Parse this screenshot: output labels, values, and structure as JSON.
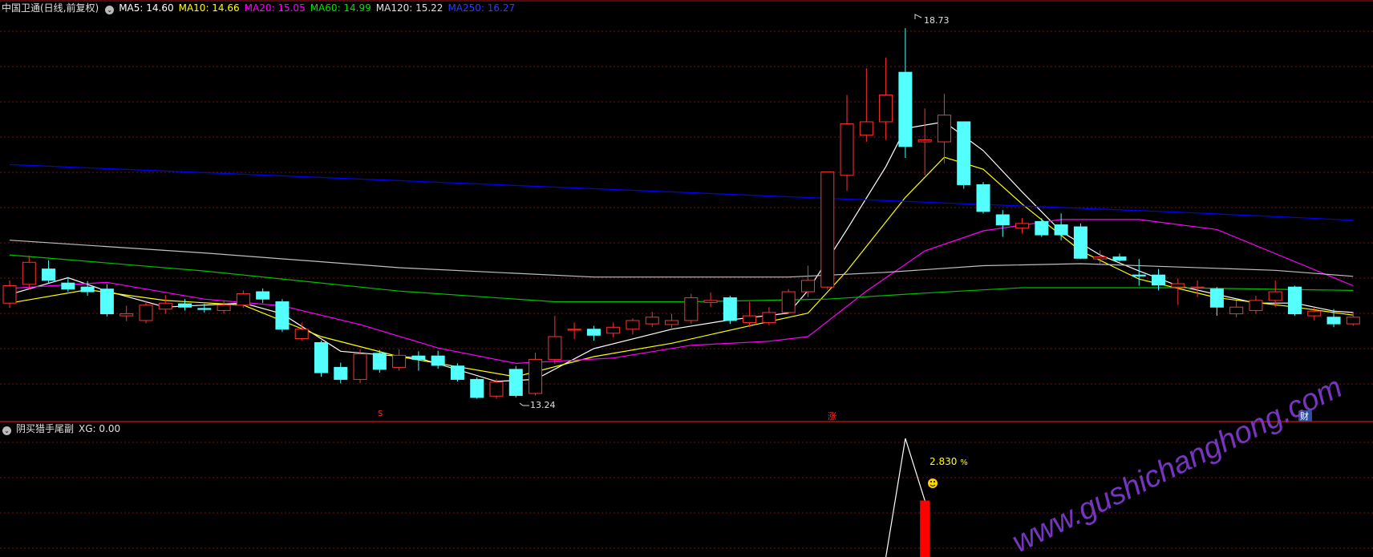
{
  "main_header": {
    "stock": "中国卫通(日线,前复权)",
    "ma5": "MA5: 14.60",
    "ma10": "MA10: 14.66",
    "ma20": "MA20: 15.05",
    "ma60": "MA60: 14.99",
    "ma120": "MA120: 15.22",
    "ma250": "MA250: 16.27"
  },
  "sub_header": {
    "indicator": "阴买猎手尾副",
    "value": "XG: 0.00"
  },
  "annotations": {
    "high": "18.73",
    "low": "13.24",
    "signal_pct": "2.830",
    "pct_unit": "%",
    "marker_s": "S",
    "marker_zhang": "涨",
    "marker_cai": "财"
  },
  "watermark": "www.gushichanghong.com",
  "colors": {
    "background": "#000000",
    "up": "#ff3232",
    "down": "#54ffff",
    "ma5": "#ffffff",
    "ma10": "#ffff00",
    "ma20": "#ff00ff",
    "ma60": "#00c000",
    "ma120": "#c0c0c0",
    "ma250": "#0000ff",
    "grid": "#7a1010",
    "watermark": "#8a3ee0"
  },
  "chart_data": [
    {
      "type": "candlestick",
      "ylim": [
        12.85,
        19.15
      ],
      "candles": [
        [
          14.62,
          14.88,
          14.55,
          14.96
        ],
        [
          14.9,
          15.23,
          14.83,
          15.33
        ],
        [
          15.13,
          14.96,
          14.91,
          15.26
        ],
        [
          14.92,
          14.83,
          14.79,
          15.01
        ],
        [
          14.86,
          14.79,
          14.73,
          14.95
        ],
        [
          14.83,
          14.46,
          14.42,
          14.9
        ],
        [
          14.43,
          14.46,
          14.35,
          14.58
        ],
        [
          14.36,
          14.59,
          14.32,
          14.66
        ],
        [
          14.53,
          14.62,
          14.46,
          14.74
        ],
        [
          14.61,
          14.56,
          14.51,
          14.68
        ],
        [
          14.54,
          14.53,
          14.48,
          14.61
        ],
        [
          14.51,
          14.59,
          14.46,
          14.66
        ],
        [
          14.59,
          14.76,
          14.55,
          14.81
        ],
        [
          14.79,
          14.68,
          14.62,
          14.84
        ],
        [
          14.64,
          14.23,
          14.19,
          14.68
        ],
        [
          14.09,
          14.23,
          14.06,
          14.33
        ],
        [
          14.03,
          13.58,
          13.52,
          14.06
        ],
        [
          13.66,
          13.48,
          13.42,
          13.73
        ],
        [
          13.48,
          13.86,
          13.42,
          13.93
        ],
        [
          13.87,
          13.63,
          13.58,
          13.92
        ],
        [
          13.66,
          13.84,
          13.61,
          13.93
        ],
        [
          13.83,
          13.78,
          13.61,
          13.9
        ],
        [
          13.83,
          13.69,
          13.64,
          13.91
        ],
        [
          13.68,
          13.48,
          13.45,
          13.72
        ],
        [
          13.48,
          13.21,
          13.19,
          13.51
        ],
        [
          13.23,
          13.44,
          13.19,
          13.49
        ],
        [
          13.63,
          13.24,
          13.21,
          13.68
        ],
        [
          13.27,
          13.78,
          13.24,
          13.88
        ],
        [
          13.78,
          14.12,
          13.71,
          14.43
        ],
        [
          14.23,
          14.23,
          14.08,
          14.33
        ],
        [
          14.23,
          14.14,
          14.06,
          14.28
        ],
        [
          14.17,
          14.26,
          14.11,
          14.33
        ],
        [
          14.23,
          14.36,
          14.15,
          14.39
        ],
        [
          14.31,
          14.41,
          14.26,
          14.49
        ],
        [
          14.3,
          14.36,
          14.25,
          14.46
        ],
        [
          14.36,
          14.7,
          14.31,
          14.76
        ],
        [
          14.63,
          14.66,
          14.56,
          14.78
        ],
        [
          14.7,
          14.36,
          14.31,
          14.73
        ],
        [
          14.33,
          14.43,
          14.26,
          14.64
        ],
        [
          14.33,
          14.48,
          14.29,
          14.56
        ],
        [
          14.48,
          14.79,
          14.46,
          14.83
        ],
        [
          14.79,
          14.96,
          14.71,
          15.18
        ],
        [
          14.86,
          16.58,
          14.82,
          16.58
        ],
        [
          16.53,
          17.3,
          16.3,
          17.73
        ],
        [
          17.13,
          17.33,
          17.03,
          18.13
        ],
        [
          17.33,
          17.73,
          17.06,
          18.29
        ],
        [
          18.07,
          16.96,
          16.79,
          18.73
        ],
        [
          17.03,
          17.06,
          16.53,
          17.53
        ],
        [
          17.03,
          17.43,
          16.71,
          17.75
        ],
        [
          17.33,
          16.39,
          16.33,
          17.33
        ],
        [
          16.39,
          15.99,
          15.96,
          16.43
        ],
        [
          15.94,
          15.79,
          15.61,
          16.01
        ],
        [
          15.74,
          15.81,
          15.66,
          15.89
        ],
        [
          15.84,
          15.64,
          15.61,
          15.89
        ],
        [
          15.79,
          15.64,
          15.56,
          15.96
        ],
        [
          15.76,
          15.29,
          15.28,
          15.81
        ],
        [
          15.28,
          15.31,
          15.21,
          15.41
        ],
        [
          15.31,
          15.26,
          15.24,
          15.36
        ],
        [
          15.04,
          15.03,
          14.88,
          15.28
        ],
        [
          15.04,
          14.89,
          14.81,
          15.13
        ],
        [
          14.86,
          14.91,
          14.59,
          14.99
        ],
        [
          14.86,
          14.86,
          14.71,
          14.96
        ],
        [
          14.83,
          14.56,
          14.43,
          14.86
        ],
        [
          14.46,
          14.56,
          14.41,
          14.66
        ],
        [
          14.51,
          14.66,
          14.46,
          14.73
        ],
        [
          14.66,
          14.79,
          14.56,
          14.96
        ],
        [
          14.86,
          14.46,
          14.43,
          14.88
        ],
        [
          14.43,
          14.5,
          14.36,
          14.56
        ],
        [
          14.41,
          14.31,
          14.26,
          14.53
        ],
        [
          14.31,
          14.41,
          14.28,
          14.49
        ]
      ],
      "ma": {
        "MA5": [
          [
            0,
            14.75
          ],
          [
            3,
            15.0
          ],
          [
            5,
            14.8
          ],
          [
            8,
            14.56
          ],
          [
            12,
            14.62
          ],
          [
            14,
            14.46
          ],
          [
            17,
            13.9
          ],
          [
            21,
            13.8
          ],
          [
            25,
            13.45
          ],
          [
            27,
            13.48
          ],
          [
            30,
            13.94
          ],
          [
            34,
            14.23
          ],
          [
            37,
            14.37
          ],
          [
            40,
            14.47
          ],
          [
            41,
            14.81
          ],
          [
            43,
            15.72
          ],
          [
            45,
            16.66
          ],
          [
            46,
            17.23
          ],
          [
            48,
            17.33
          ],
          [
            50,
            16.9
          ],
          [
            52,
            16.28
          ],
          [
            54,
            15.69
          ],
          [
            56,
            15.34
          ],
          [
            58,
            15.1
          ],
          [
            60,
            14.88
          ],
          [
            62,
            14.75
          ],
          [
            64,
            14.62
          ],
          [
            66,
            14.62
          ],
          [
            68,
            14.5
          ],
          [
            69,
            14.48
          ]
        ],
        "MA10": [
          [
            0,
            14.62
          ],
          [
            4,
            14.82
          ],
          [
            8,
            14.66
          ],
          [
            12,
            14.59
          ],
          [
            16,
            14.12
          ],
          [
            20,
            13.82
          ],
          [
            26,
            13.52
          ],
          [
            30,
            13.82
          ],
          [
            34,
            14.02
          ],
          [
            38,
            14.28
          ],
          [
            41,
            14.47
          ],
          [
            43,
            15.1
          ],
          [
            46,
            16.2
          ],
          [
            48,
            16.8
          ],
          [
            50,
            16.62
          ],
          [
            52,
            16.1
          ],
          [
            55,
            15.4
          ],
          [
            58,
            14.98
          ],
          [
            62,
            14.7
          ],
          [
            66,
            14.56
          ],
          [
            69,
            14.44
          ]
        ],
        "MA20": [
          [
            0,
            14.84
          ],
          [
            5,
            14.93
          ],
          [
            10,
            14.68
          ],
          [
            14,
            14.58
          ],
          [
            18,
            14.3
          ],
          [
            22,
            13.95
          ],
          [
            26,
            13.72
          ],
          [
            31,
            13.8
          ],
          [
            35,
            13.99
          ],
          [
            39,
            14.05
          ],
          [
            41,
            14.12
          ],
          [
            44,
            14.8
          ],
          [
            47,
            15.4
          ],
          [
            50,
            15.7
          ],
          [
            54,
            15.87
          ],
          [
            58,
            15.87
          ],
          [
            62,
            15.72
          ],
          [
            67,
            15.12
          ],
          [
            69,
            14.88
          ]
        ],
        "MA60": [
          [
            0,
            15.34
          ],
          [
            10,
            15.1
          ],
          [
            20,
            14.8
          ],
          [
            28,
            14.64
          ],
          [
            35,
            14.64
          ],
          [
            42,
            14.68
          ],
          [
            47,
            14.77
          ],
          [
            52,
            14.85
          ],
          [
            60,
            14.85
          ],
          [
            69,
            14.81
          ]
        ],
        "MA120": [
          [
            0,
            15.56
          ],
          [
            10,
            15.37
          ],
          [
            20,
            15.15
          ],
          [
            30,
            15.01
          ],
          [
            40,
            15.01
          ],
          [
            45,
            15.08
          ],
          [
            50,
            15.18
          ],
          [
            55,
            15.21
          ],
          [
            65,
            15.11
          ],
          [
            69,
            15.02
          ]
        ],
        "MA250": [
          [
            0,
            16.69
          ],
          [
            20,
            16.45
          ],
          [
            40,
            16.21
          ],
          [
            60,
            15.98
          ],
          [
            69,
            15.86
          ]
        ]
      }
    },
    {
      "type": "line+bar",
      "ylim": [
        -1.0,
        11.0
      ],
      "line": [
        [
          45,
          -1
        ],
        [
          46,
          9.5
        ],
        [
          47,
          4.0
        ]
      ],
      "bars": [
        [
          47,
          4.0
        ]
      ]
    }
  ]
}
